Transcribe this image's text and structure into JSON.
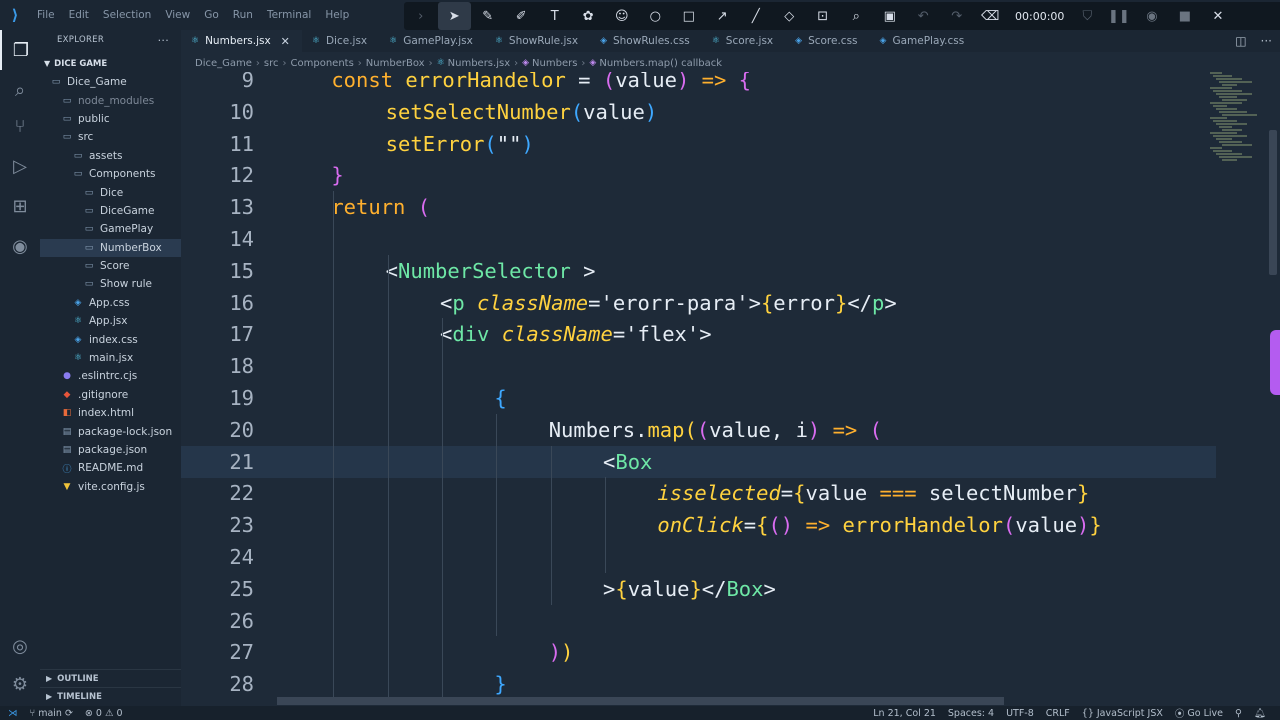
{
  "menu": [
    "File",
    "Edit",
    "Selection",
    "View",
    "Go",
    "Run",
    "Terminal",
    "Help"
  ],
  "drawing_toolbar": {
    "timer": "00:00:00",
    "tools": [
      "chevron-icon",
      "cursor-icon",
      "pen-icon",
      "highlighter-icon",
      "text-icon",
      "stamp-icon",
      "emoji-icon",
      "circle-icon",
      "square-icon",
      "arrow-icon",
      "line-icon",
      "eraser-icon",
      "screenshot-icon",
      "zoom-icon",
      "whiteboard-icon",
      "undo-icon",
      "redo-icon",
      "clear-icon"
    ]
  },
  "sidebar": {
    "title": "EXPLORER",
    "root": "DICE GAME",
    "items": [
      {
        "label": "Dice_Game",
        "indent": 0,
        "icon": "folder-icon"
      },
      {
        "label": "node_modules",
        "indent": 1,
        "icon": "folder-icon",
        "dim": true
      },
      {
        "label": "public",
        "indent": 1,
        "icon": "folder-icon"
      },
      {
        "label": "src",
        "indent": 1,
        "icon": "folder-icon"
      },
      {
        "label": "assets",
        "indent": 2,
        "icon": "folder-icon"
      },
      {
        "label": "Components",
        "indent": 2,
        "icon": "folder-icon"
      },
      {
        "label": "Dice",
        "indent": 3,
        "icon": "folder-icon"
      },
      {
        "label": "DiceGame",
        "indent": 3,
        "icon": "folder-icon"
      },
      {
        "label": "GamePlay",
        "indent": 3,
        "icon": "folder-icon"
      },
      {
        "label": "NumberBox",
        "indent": 3,
        "icon": "folder-icon",
        "selected": true
      },
      {
        "label": "Score",
        "indent": 3,
        "icon": "folder-icon"
      },
      {
        "label": "Show rule",
        "indent": 3,
        "icon": "folder-icon"
      },
      {
        "label": "App.css",
        "indent": 2,
        "icon": "css-file-icon"
      },
      {
        "label": "App.jsx",
        "indent": 2,
        "icon": "react-file-icon"
      },
      {
        "label": "index.css",
        "indent": 2,
        "icon": "css-file-icon"
      },
      {
        "label": "main.jsx",
        "indent": 2,
        "icon": "react-file-icon"
      },
      {
        "label": ".eslintrc.cjs",
        "indent": 1,
        "icon": "eslint-file-icon"
      },
      {
        "label": ".gitignore",
        "indent": 1,
        "icon": "git-file-icon"
      },
      {
        "label": "index.html",
        "indent": 1,
        "icon": "html-file-icon"
      },
      {
        "label": "package-lock.json",
        "indent": 1,
        "icon": "json-file-icon"
      },
      {
        "label": "package.json",
        "indent": 1,
        "icon": "json-file-icon"
      },
      {
        "label": "README.md",
        "indent": 1,
        "icon": "info-file-icon"
      },
      {
        "label": "vite.config.js",
        "indent": 1,
        "icon": "vite-file-icon"
      }
    ],
    "outline": "OUTLINE",
    "timeline": "TIMELINE"
  },
  "tabs": [
    {
      "label": "Numbers.jsx",
      "active": true,
      "icon": "react-file-icon"
    },
    {
      "label": "Dice.jsx",
      "icon": "react-file-icon"
    },
    {
      "label": "GamePlay.jsx",
      "icon": "react-file-icon"
    },
    {
      "label": "ShowRule.jsx",
      "icon": "react-file-icon"
    },
    {
      "label": "ShowRules.css",
      "icon": "css-file-icon"
    },
    {
      "label": "Score.jsx",
      "icon": "react-file-icon"
    },
    {
      "label": "Score.css",
      "icon": "css-file-icon"
    },
    {
      "label": "GamePlay.css",
      "icon": "css-file-icon"
    }
  ],
  "breadcrumb": [
    "Dice_Game",
    "src",
    "Components",
    "NumberBox",
    "Numbers.jsx",
    "Numbers",
    "Numbers.map() callback"
  ],
  "code_lines": [
    {
      "n": "9",
      "indent": 1,
      "tokens": [
        [
          "kw",
          "const "
        ],
        [
          "fn",
          "errorHandelor"
        ],
        [
          "pun",
          " = "
        ],
        [
          "b2",
          "("
        ],
        [
          "var",
          "value"
        ],
        [
          "b2",
          ")"
        ],
        [
          "pun",
          " "
        ],
        [
          "kw",
          "=>"
        ],
        [
          "pun",
          " "
        ],
        [
          "b2",
          "{"
        ]
      ]
    },
    {
      "n": "10",
      "indent": 2,
      "tokens": [
        [
          "fn",
          "setSelectNumber"
        ],
        [
          "b3",
          "("
        ],
        [
          "var",
          "value"
        ],
        [
          "b3",
          ")"
        ]
      ]
    },
    {
      "n": "11",
      "indent": 2,
      "tokens": [
        [
          "fn",
          "setError"
        ],
        [
          "b3",
          "("
        ],
        [
          "str",
          "\"\""
        ],
        [
          "b3",
          ")"
        ]
      ]
    },
    {
      "n": "12",
      "indent": 1,
      "tokens": [
        [
          "b2",
          "}"
        ]
      ]
    },
    {
      "n": "13",
      "indent": 1,
      "tokens": [
        [
          "kw",
          "return "
        ],
        [
          "b2",
          "("
        ]
      ]
    },
    {
      "n": "14",
      "indent": 0,
      "tokens": []
    },
    {
      "n": "15",
      "indent": 2,
      "tokens": [
        [
          "pun",
          "<"
        ],
        [
          "tag",
          "NumberSelector"
        ],
        [
          "pun",
          " >"
        ]
      ]
    },
    {
      "n": "16",
      "indent": 3,
      "tokens": [
        [
          "pun",
          "<"
        ],
        [
          "tag",
          "p"
        ],
        [
          "pun",
          " "
        ],
        [
          "attr",
          "className"
        ],
        [
          "pun",
          "="
        ],
        [
          "str",
          "'erorr-para'"
        ],
        [
          "pun",
          ">"
        ],
        [
          "b1",
          "{"
        ],
        [
          "var",
          "error"
        ],
        [
          "b1",
          "}"
        ],
        [
          "pun",
          "</"
        ],
        [
          "tag",
          "p"
        ],
        [
          "pun",
          ">"
        ]
      ]
    },
    {
      "n": "17",
      "indent": 3,
      "tokens": [
        [
          "pun",
          "<"
        ],
        [
          "tag",
          "div"
        ],
        [
          "pun",
          " "
        ],
        [
          "attr",
          "className"
        ],
        [
          "pun",
          "="
        ],
        [
          "str",
          "'flex'"
        ],
        [
          "pun",
          ">"
        ]
      ]
    },
    {
      "n": "18",
      "indent": 0,
      "tokens": []
    },
    {
      "n": "19",
      "indent": 4,
      "tokens": [
        [
          "b3",
          "{"
        ]
      ]
    },
    {
      "n": "20",
      "indent": 5,
      "tokens": [
        [
          "var",
          "Numbers"
        ],
        [
          "pun",
          "."
        ],
        [
          "fn",
          "map"
        ],
        [
          "b1",
          "("
        ],
        [
          "b2",
          "("
        ],
        [
          "var",
          "value"
        ],
        [
          "pun",
          ", "
        ],
        [
          "var",
          "i"
        ],
        [
          "b2",
          ")"
        ],
        [
          "pun",
          " "
        ],
        [
          "kw",
          "=>"
        ],
        [
          "pun",
          " "
        ],
        [
          "b2",
          "("
        ]
      ]
    },
    {
      "n": "21",
      "indent": 6,
      "current": true,
      "tokens": [
        [
          "pun",
          "<"
        ],
        [
          "tag",
          "Box"
        ]
      ]
    },
    {
      "n": "22",
      "indent": 7,
      "tokens": [
        [
          "attr",
          "isselected"
        ],
        [
          "pun",
          "="
        ],
        [
          "b1",
          "{"
        ],
        [
          "var",
          "value"
        ],
        [
          "pun",
          " "
        ],
        [
          "kw",
          "==="
        ],
        [
          "pun",
          " "
        ],
        [
          "var",
          "selectNumber"
        ],
        [
          "b1",
          "}"
        ]
      ]
    },
    {
      "n": "23",
      "indent": 7,
      "tokens": [
        [
          "attr",
          "onClick"
        ],
        [
          "pun",
          "="
        ],
        [
          "b1",
          "{"
        ],
        [
          "b2",
          "()"
        ],
        [
          "pun",
          " "
        ],
        [
          "kw",
          "=>"
        ],
        [
          "pun",
          " "
        ],
        [
          "fn",
          "errorHandelor"
        ],
        [
          "b2",
          "("
        ],
        [
          "var",
          "value"
        ],
        [
          "b2",
          ")"
        ],
        [
          "b1",
          "}"
        ]
      ]
    },
    {
      "n": "24",
      "indent": 0,
      "tokens": []
    },
    {
      "n": "25",
      "indent": 6,
      "tokens": [
        [
          "pun",
          ">"
        ],
        [
          "b1",
          "{"
        ],
        [
          "var",
          "value"
        ],
        [
          "b1",
          "}"
        ],
        [
          "pun",
          "</"
        ],
        [
          "tag",
          "Box"
        ],
        [
          "pun",
          ">"
        ]
      ]
    },
    {
      "n": "26",
      "indent": 0,
      "tokens": []
    },
    {
      "n": "27",
      "indent": 5,
      "tokens": [
        [
          "b2",
          ")"
        ],
        [
          "b1",
          ")"
        ]
      ]
    },
    {
      "n": "28",
      "indent": 4,
      "tokens": [
        [
          "b3",
          "}"
        ]
      ]
    }
  ],
  "status": {
    "branch": "main",
    "problems": "0",
    "warnings": "0",
    "position": "Ln 21, Col 21",
    "spaces": "Spaces: 4",
    "encoding": "UTF-8",
    "eol": "CRLF",
    "language": "JavaScript JSX",
    "live": "Go Live"
  }
}
